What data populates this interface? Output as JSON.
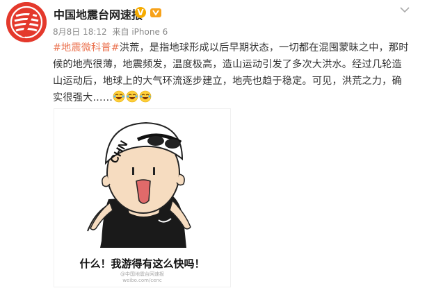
{
  "header": {
    "username": "中国地震台网速报",
    "timestamp": "8月8日 18:12",
    "source": "来自 iPhone 6"
  },
  "post": {
    "hashtag": "#地震微科普#",
    "body_line1_rest": "洪荒，是指地球形成以后早期状态，一切都在混囤蒙昧之中，那时",
    "body_line2": "候的地壳很薄，地震频发，温度极高，造山运动引发了多次大洪水。经过几轮造",
    "body_line3": "山运动后，地球上的大气环流逐步建立，地壳也趋于稳定。可见，洪荒之力，确",
    "body_line4": "实很强大……",
    "emojis": [
      "laugh-cry-emoji",
      "laugh-cry-emoji",
      "laugh-cry-emoji"
    ]
  },
  "meme": {
    "cap_text": "CHN",
    "caption": "什么！我游得有这么快吗！",
    "watermark_line1": "@中国地震台网速报",
    "watermark_line2": "weibo.com/cenc"
  },
  "colors": {
    "brand_red": "#e4392c",
    "hashtag": "#eb7350",
    "verified": "#f6ab00"
  }
}
